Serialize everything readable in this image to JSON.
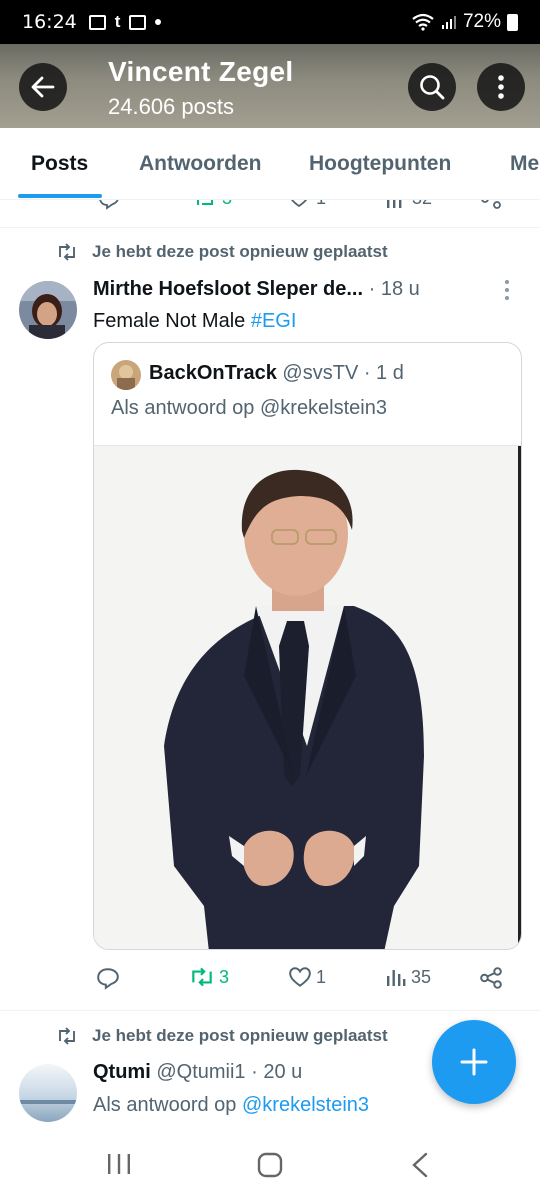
{
  "status_bar": {
    "time": "16:24",
    "notif_t": "t",
    "battery": "72%"
  },
  "header": {
    "title": "Vincent Zegel",
    "subtitle": "24.606 posts"
  },
  "tabs": [
    {
      "label": "Posts",
      "active": true
    },
    {
      "label": "Antwoorden",
      "active": false
    },
    {
      "label": "Hoogtepunten",
      "active": false
    },
    {
      "label": "Me",
      "active": false
    }
  ],
  "partial_row": {
    "retweets": "3",
    "likes": "1",
    "views": "32"
  },
  "post1": {
    "repost_label": "Je hebt deze post opnieuw geplaatst",
    "author_name": "Mirthe Hoefsloot Sleper de...",
    "time": "· 18 u",
    "text": "Female Not Male",
    "hashtag": "#EGI",
    "quote": {
      "name": "BackOnTrack",
      "handle": "@svsTV",
      "time": "· 1 d",
      "reply_to": "Als antwoord op @krekelstein3"
    },
    "actions": {
      "retweets": "3",
      "likes": "1",
      "views": "35"
    }
  },
  "post2": {
    "repost_label": "Je hebt deze post opnieuw geplaatst",
    "author_name": "Qtumi",
    "handle": "@Qtumii1",
    "time": "· 20 u",
    "reply_prefix": "Als antwoord op",
    "reply_to": "@krekelstein3"
  },
  "colors": {
    "accent": "#1d9bf0",
    "repost_green": "#00ba7c",
    "muted_text": "#536471"
  }
}
